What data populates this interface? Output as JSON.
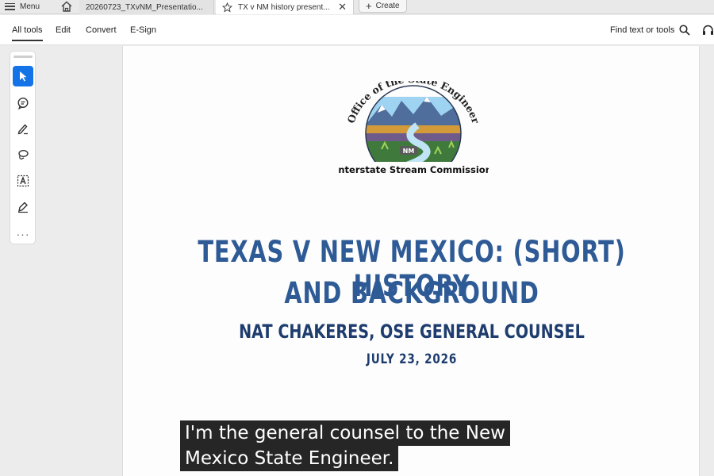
{
  "tabbar": {
    "menu_label": "Menu",
    "tabs": [
      {
        "label": "20260723_TXvNM_Presentatio..."
      },
      {
        "label": "TX v NM history present..."
      }
    ],
    "create_label": "Create"
  },
  "toolbar": {
    "tabs": [
      {
        "label": "All tools"
      },
      {
        "label": "Edit"
      },
      {
        "label": "Convert"
      },
      {
        "label": "E-Sign"
      }
    ],
    "find_label": "Find text or tools"
  },
  "left_tools": [
    "select-cursor-icon",
    "add-comment-icon",
    "draw-pen-icon",
    "lasso-icon",
    "text-recognition-icon",
    "fill-sign-icon"
  ],
  "document": {
    "logo": {
      "arc_text": "Office of the State Engineer",
      "badge_text": "NM",
      "bottom_text": "Interstate Stream Commission"
    },
    "title_line1": "TEXAS V NEW MEXICO: (SHORT) HISTORY",
    "title_line2": "AND BACKGROUND",
    "presenter": "NAT CHAKERES, OSE GENERAL COUNSEL",
    "date": "JULY 23, 2026"
  },
  "captions": {
    "line1": "I'm the general counsel to the New",
    "line2": "Mexico State Engineer."
  },
  "colors": {
    "accent": "#1473e6",
    "title": "#2e5a96",
    "subtitle": "#1e3d6e",
    "caption_bg": "#262626"
  }
}
